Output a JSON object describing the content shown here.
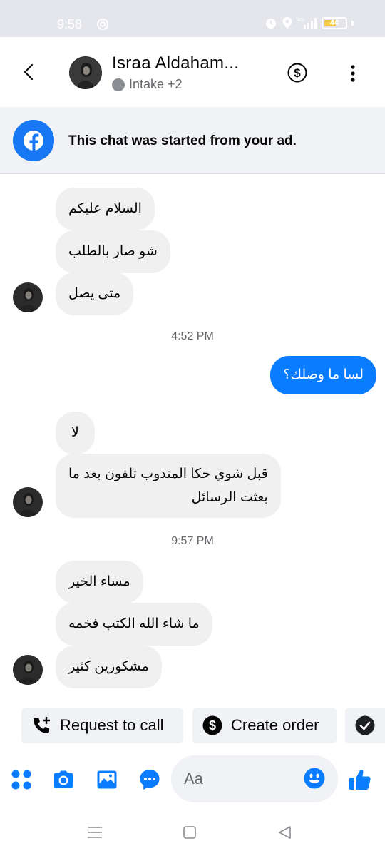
{
  "status_bar": {
    "time": "9:58",
    "battery": "44",
    "network": "4G"
  },
  "header": {
    "contact_name": "Israa Aldaham...",
    "label_text": "Intake +2"
  },
  "ad_banner": {
    "text": "This chat was started from your ad."
  },
  "messages": [
    {
      "side": "in",
      "text": "السلام عليكم"
    },
    {
      "side": "in",
      "text": "شو صار بالطلب"
    },
    {
      "side": "in",
      "text": "متى يصل"
    },
    {
      "type": "time",
      "text": "4:52 PM"
    },
    {
      "side": "out",
      "text": "لسا ما وصلك؟"
    },
    {
      "side": "in",
      "text": "لا"
    },
    {
      "side": "in",
      "text": "قبل شوي حكا المندوب تلفون بعد ما",
      "text2": "بعثت الرسائل"
    },
    {
      "type": "time",
      "text": "9:57 PM"
    },
    {
      "side": "in",
      "text": "مساء الخير"
    },
    {
      "side": "in",
      "text": "ما شاء الله الكتب فخمه"
    },
    {
      "side": "in",
      "text": "مشكورين كثير"
    }
  ],
  "quick_actions": {
    "request_call": "Request to call",
    "create_order": "Create order"
  },
  "composer": {
    "placeholder": "Aa"
  },
  "colors": {
    "accent": "#0a7cff",
    "incoming_bubble": "#f0f0f0",
    "facebook_blue": "#1877f2"
  },
  "icons": [
    "back-icon",
    "dollar-icon",
    "more-icon",
    "facebook-icon",
    "phone-plus-icon",
    "dollar-circle-icon",
    "check-circle-icon",
    "apps-icon",
    "camera-icon",
    "gallery-icon",
    "chat-bubble-icon",
    "emoji-icon",
    "like-icon"
  ]
}
